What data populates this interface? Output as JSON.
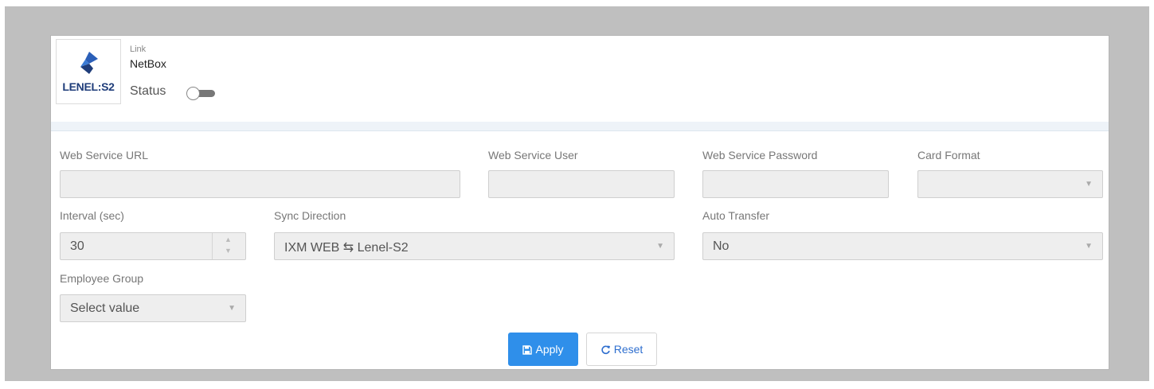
{
  "integration": {
    "logo_text": "LENEL:S2",
    "link_label": "Link",
    "link_name": "NetBox",
    "status_label": "Status",
    "status_on": false
  },
  "fields": {
    "web_service_url": {
      "label": "Web Service URL",
      "value": ""
    },
    "web_service_user": {
      "label": "Web Service User",
      "value": ""
    },
    "web_service_password": {
      "label": "Web Service Password",
      "value": ""
    },
    "card_format": {
      "label": "Card Format",
      "value": ""
    },
    "interval": {
      "label": "Interval (sec)",
      "value": "30"
    },
    "sync_direction": {
      "label": "Sync Direction",
      "value": "IXM WEB ⇆ Lenel-S2"
    },
    "auto_transfer": {
      "label": "Auto Transfer",
      "value": "No"
    },
    "employee_group": {
      "label": "Employee Group",
      "value": "Select value"
    }
  },
  "buttons": {
    "apply": "Apply",
    "reset": "Reset"
  },
  "colors": {
    "accent": "#2f8fea",
    "logo": "#1f3d7a"
  }
}
